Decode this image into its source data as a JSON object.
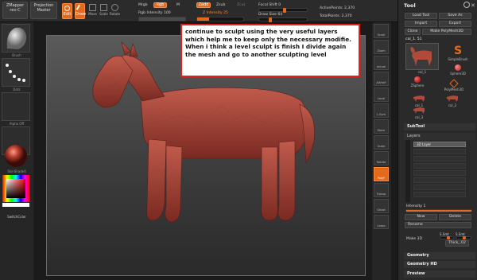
{
  "topbar": {
    "zmapper": "ZMapper",
    "rev": "rev-C",
    "projection_master": "Projection\nMaster",
    "tools": [
      "Edit",
      "Draw",
      "Move",
      "Scale",
      "Rotate"
    ],
    "mrgb": "Mrgb",
    "rgb": "Rgb",
    "m": "M",
    "zadd": "Zadd",
    "zsub": "Zsub",
    "zcut": "Zcut",
    "rgb_intensity_label": "Rgb Intensity",
    "rgb_intensity_value": "100",
    "z_intensity_label": "Z Intensity",
    "z_intensity_value": "25",
    "focal_shift_label": "Focal Shift",
    "focal_shift_value": "0",
    "draw_size_label": "Draw Size",
    "draw_size_value": "64",
    "active_points_label": "ActivePoints:",
    "active_points_value": "2,370",
    "total_points_label": "TotalPoints:",
    "total_points_value": "2,370"
  },
  "left_tray": {
    "material_label": "Brush",
    "stroke_label": "Dots",
    "alpha_label": "Alpha Off",
    "texture_label": "Texture Off",
    "mat_label": "SkinShade4",
    "switch_color": "SwitchColor"
  },
  "right_shelf": [
    "Scroll",
    "Zoom",
    "Actual",
    "AAHalf",
    "Local",
    "L.Sym",
    "Move",
    "Scale",
    "Rotate",
    "PolyF",
    "Transp",
    "Ghost",
    "Lasso"
  ],
  "palette": {
    "title": "Tool",
    "load_tool": "Load Tool",
    "save_as": "Save As",
    "import": "Import",
    "export": "Export",
    "clone": "Clone",
    "make_polymesh": "Make PolyMesh3D",
    "current_tool": "cal_1. 51",
    "thumbs": [
      "cal_1",
      "SimpleBrush",
      "Sphere3D",
      "ZSphere",
      "PolyMesh3D",
      "cal_1",
      "cal_2",
      "cal_3"
    ],
    "subtool": "SubTool",
    "layers": "Layers",
    "layer_name": "3D Layer",
    "intensity_label": "Intensity",
    "intensity_value": "1",
    "new": "New",
    "delete": "Delete",
    "rename": "Rename",
    "make_3d": "Make 3D",
    "s_smt": "S.Smt",
    "thick": "Thick_.02",
    "geometry": "Geometry",
    "geometry_hd": "Geometry HD",
    "preview": "Preview"
  },
  "note": {
    "line1": "continue to sculpt using the very useful layers which help me to keep only the necessary modifie.",
    "line2": "When i think a level sculpt is finish I divide again the mesh and go to another sculpting level"
  },
  "colors": {
    "accent": "#e46a1b",
    "horse": "#a8463a",
    "note_border": "#dd2222"
  }
}
